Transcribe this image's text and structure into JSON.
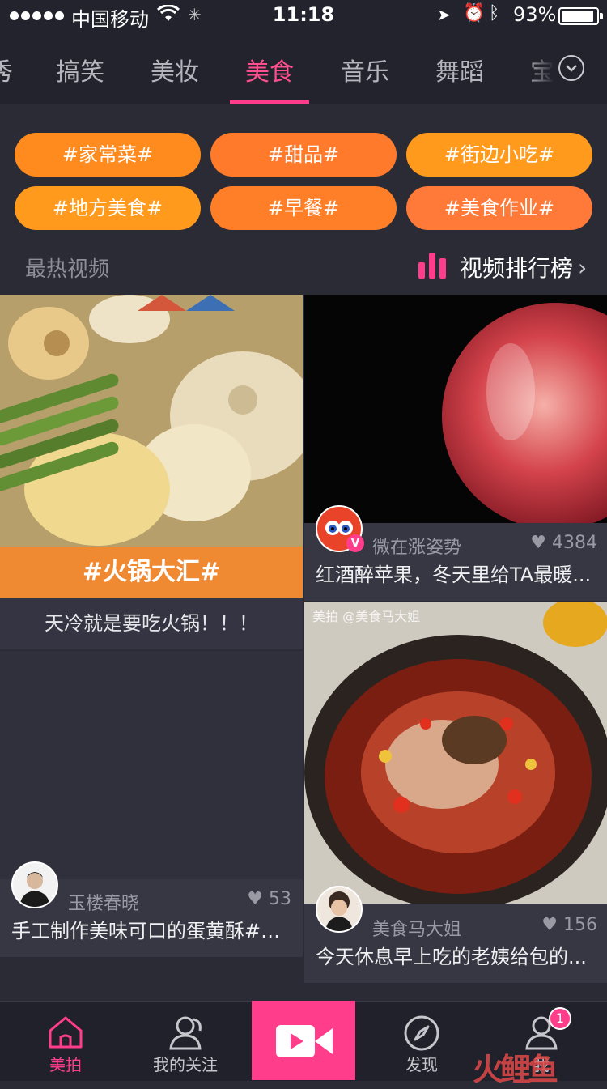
{
  "status_bar": {
    "carrier": "中国移动",
    "time": "11:18",
    "battery": "93%",
    "battery_level": 0.93
  },
  "tabs": [
    {
      "label": "秀",
      "active": false
    },
    {
      "label": "搞笑",
      "active": false
    },
    {
      "label": "美妆",
      "active": false
    },
    {
      "label": "美食",
      "active": true
    },
    {
      "label": "音乐",
      "active": false
    },
    {
      "label": "舞蹈",
      "active": false
    },
    {
      "label": "宝",
      "active": false
    }
  ],
  "tags": [
    "#家常菜#",
    "#甜品#",
    "#街边小吃#",
    "#地方美食#",
    "#早餐#",
    "#美食作业#"
  ],
  "section": {
    "hot_title": "最热视频",
    "rank_label": "视频排行榜"
  },
  "topic_card": {
    "banner": "#火锅大汇#",
    "subtitle": "天冷就是要吃火锅！！！"
  },
  "videos": [
    {
      "user": "微在涨姿势",
      "likes": "4384",
      "desc": "红酒醉苹果，冬天里给TA最暖..."
    },
    {
      "user": "玉楼春晓",
      "likes": "53",
      "desc": "手工制作美味可口的蛋黄酥#美..."
    },
    {
      "user": "美食马大姐",
      "likes": "156",
      "desc": "今天休息早上吃的老姨给包的...",
      "overlay": "美拍 @美食马大姐"
    }
  ],
  "nav": {
    "home": "美拍",
    "follow": "我的关注",
    "discover": "发现",
    "me": "我",
    "badge": "1",
    "watermark": "火鲤鱼"
  },
  "colors": {
    "accent": "#ff3d8a",
    "tag_orange": "#ff8a1e",
    "background": "#2b2b36"
  }
}
